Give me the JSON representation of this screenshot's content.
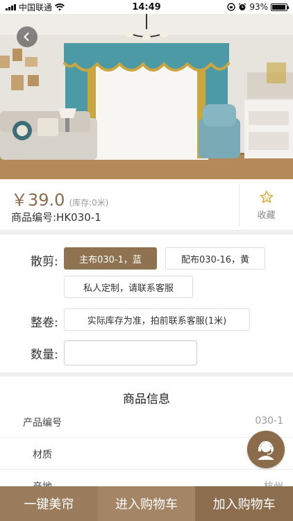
{
  "status_bar": {
    "carrier": "中国联通",
    "time": "14:49",
    "battery": "93%",
    "battery_level": 0.93
  },
  "product": {
    "price": "￥39.0",
    "stock": "(库存:0米)",
    "code_label": "商品编号:HK030-1",
    "favorite_label": "收藏"
  },
  "options": {
    "loose_cut_label": "散剪:",
    "loose_cut_choices": [
      "主布030-1，蓝",
      "配布030-16，黄",
      "私人定制，请联系客服"
    ],
    "selected_choice": "主布030-1，蓝",
    "roll_label": "整卷:",
    "roll_choice": "实际库存为准，拍前联系客服(1米)",
    "quantity_label": "数量:",
    "quantity_value": ""
  },
  "info": {
    "title": "商品信息",
    "rows": [
      {
        "key": "产品编号",
        "value": "030-1"
      },
      {
        "key": "材质",
        "value": ""
      },
      {
        "key": "产地",
        "value": "杭州"
      }
    ]
  },
  "bottom_bar": {
    "btn1": "一键美帘",
    "btn2": "进入购物车",
    "btn3": "加入购物车"
  },
  "colors": {
    "accent": "#8a6b4a",
    "chip_active": "#8f7250"
  },
  "icons": [
    "back-arrow-icon",
    "star-icon",
    "customer-service-icon",
    "wifi-icon",
    "alarm-icon",
    "lock-rotation-icon"
  ]
}
